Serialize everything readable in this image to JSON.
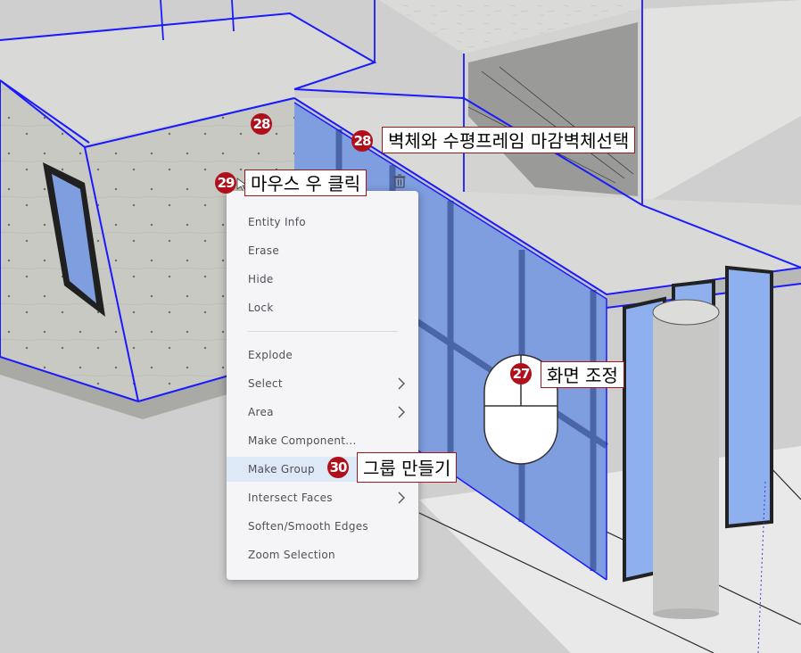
{
  "context_menu": {
    "items": [
      {
        "label": "Entity Info",
        "submenu": false
      },
      {
        "label": "Erase",
        "submenu": false
      },
      {
        "label": "Hide",
        "submenu": false
      },
      {
        "label": "Lock",
        "submenu": false
      },
      {
        "label": "Explode",
        "submenu": false
      },
      {
        "label": "Select",
        "submenu": true
      },
      {
        "label": "Area",
        "submenu": true
      },
      {
        "label": "Make Component...",
        "submenu": false
      },
      {
        "label": "Make Group",
        "submenu": false,
        "highlighted": true
      },
      {
        "label": "Intersect Faces",
        "submenu": true
      },
      {
        "label": "Soften/Smooth Edges",
        "submenu": false
      },
      {
        "label": "Zoom Selection",
        "submenu": false
      }
    ]
  },
  "annotations": {
    "step27": {
      "number": "27",
      "text": "화면 조정"
    },
    "step28": {
      "number": "28",
      "text": "벽체와 수평프레임 마감벽체선택"
    },
    "step28_marker": {
      "number": "28"
    },
    "step29": {
      "number": "29",
      "text": "마우스 우 클릭"
    },
    "step30": {
      "number": "30",
      "text": "그룹 만들기"
    }
  },
  "colors": {
    "selection_edge": "#1a1aff",
    "badge": "#b0101a",
    "callout_border": "#a01818",
    "menu_highlight": "#dde9f7",
    "glass": "#7f9ee0"
  }
}
